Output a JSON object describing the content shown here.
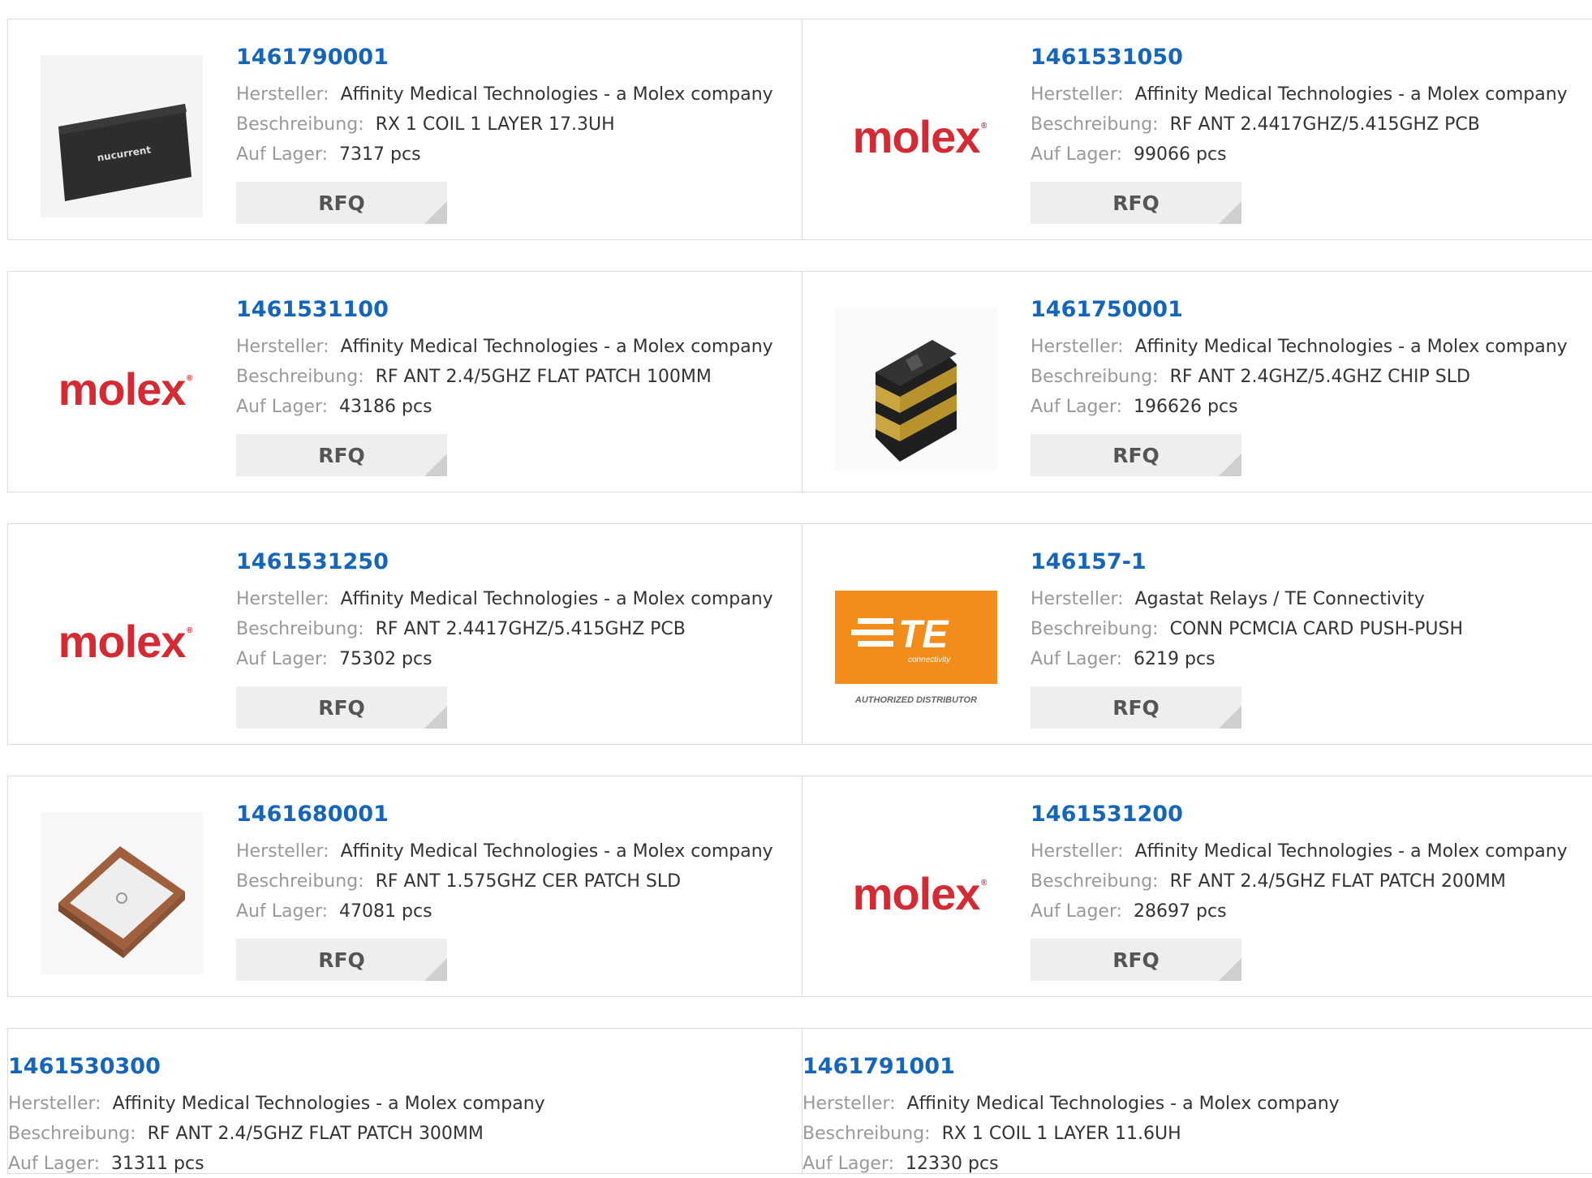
{
  "labels": {
    "manufacturer": "Hersteller:",
    "description": "Beschreibung:",
    "stock": "Auf Lager:",
    "rfq": "RFQ"
  },
  "products": [
    {
      "pn": "1461790001",
      "manufacturer": "Affinity Medical Technologies - a Molex company",
      "description": "RX 1 COIL 1 LAYER 17.3UH",
      "stock": "7317 pcs",
      "image": "nucurrent-coil",
      "image_text": "nucurrent"
    },
    {
      "pn": "1461531050",
      "manufacturer": "Affinity Medical Technologies - a Molex company",
      "description": "RF ANT 2.4417GHZ/5.415GHZ PCB",
      "stock": "99066 pcs",
      "image": "molex-logo",
      "image_text": "molex"
    },
    {
      "pn": "1461531100",
      "manufacturer": "Affinity Medical Technologies - a Molex company",
      "description": "RF ANT 2.4/5GHZ FLAT PATCH 100MM",
      "stock": "43186 pcs",
      "image": "molex-logo",
      "image_text": "molex"
    },
    {
      "pn": "1461750001",
      "manufacturer": "Affinity Medical Technologies - a Molex company",
      "description": "RF ANT 2.4GHZ/5.4GHZ CHIP SLD",
      "stock": "196626 pcs",
      "image": "chip-antenna",
      "image_text": ""
    },
    {
      "pn": "1461531250",
      "manufacturer": "Affinity Medical Technologies - a Molex company",
      "description": "RF ANT 2.4417GHZ/5.415GHZ PCB",
      "stock": "75302 pcs",
      "image": "molex-logo",
      "image_text": "molex"
    },
    {
      "pn": "146157-1",
      "manufacturer": "Agastat Relays / TE Connectivity",
      "description": "CONN PCMCIA CARD PUSH-PUSH",
      "stock": "6219 pcs",
      "image": "te-logo",
      "image_text": "TE",
      "image_subtext": "connectivity",
      "image_caption": "AUTHORIZED DISTRIBUTOR"
    },
    {
      "pn": "1461680001",
      "manufacturer": "Affinity Medical Technologies - a Molex company",
      "description": "RF ANT 1.575GHZ CER PATCH SLD",
      "stock": "47081 pcs",
      "image": "ceramic-patch",
      "image_text": ""
    },
    {
      "pn": "1461531200",
      "manufacturer": "Affinity Medical Technologies - a Molex company",
      "description": "RF ANT 2.4/5GHZ FLAT PATCH 200MM",
      "stock": "28697 pcs",
      "image": "molex-logo",
      "image_text": "molex"
    },
    {
      "pn": "1461530300",
      "manufacturer": "Affinity Medical Technologies - a Molex company",
      "description": "RF ANT 2.4/5GHZ FLAT PATCH 300MM",
      "stock": "31311 pcs",
      "image": "",
      "image_text": ""
    },
    {
      "pn": "1461791001",
      "manufacturer": "Affinity Medical Technologies - a Molex company",
      "description": "RX 1 COIL 1 LAYER 11.6UH",
      "stock": "12330 pcs",
      "image": "",
      "image_text": ""
    }
  ],
  "colors": {
    "link": "#1565b8",
    "molex_red": "#d42a34",
    "te_orange": "#f28c1b",
    "label_gray": "#999999",
    "rfq_bg": "#eeeeee"
  }
}
